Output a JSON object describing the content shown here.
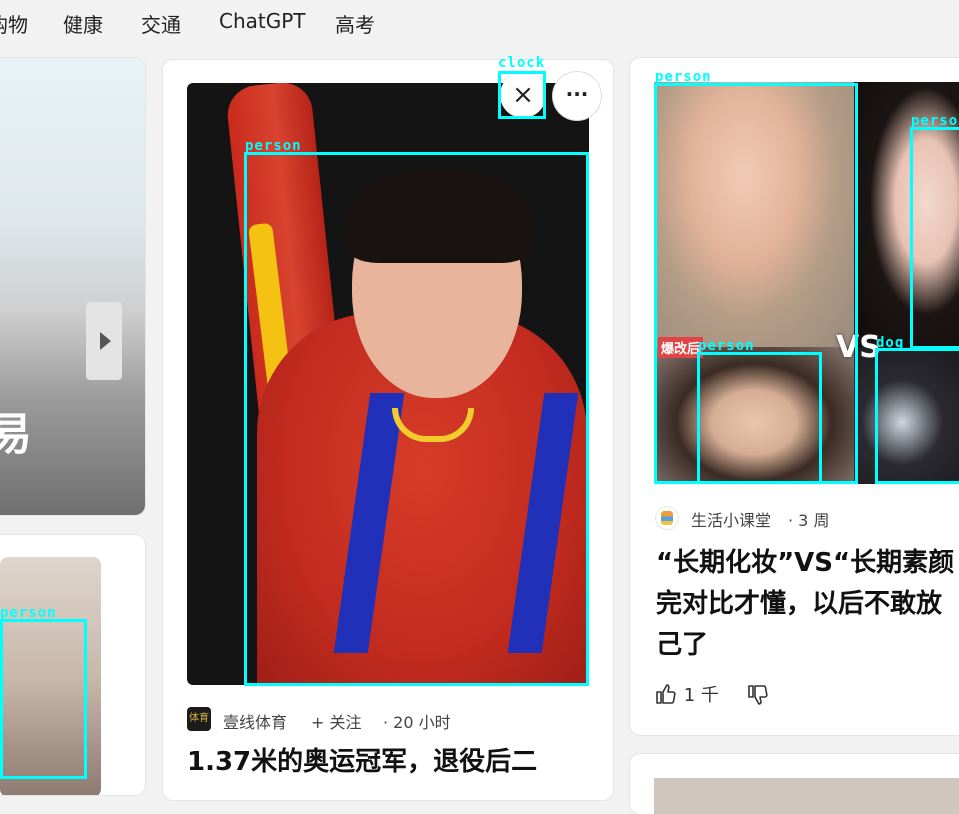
{
  "nav": {
    "items": [
      "购物",
      "健康",
      "交通",
      "ChatGPT",
      "高考"
    ]
  },
  "left_top": {
    "caption": "易"
  },
  "center_card": {
    "source": "壹线体育",
    "source_logo_text": "体育",
    "follow": "关注",
    "time": "· 20 小时",
    "title_line1": "1.37米的奥运冠军，退役后二",
    "close_glyph": "×",
    "more_glyph": "···"
  },
  "right_card": {
    "source": "生活小课堂",
    "time": "· 3 周",
    "vs_text": "VS",
    "photo_tag": "爆改后",
    "title_line1": "“长期化妆”VS“长期素颜",
    "title_line2": "完对比才懂，以后不敢放",
    "title_line3": "己了",
    "likes": "1 千",
    "like_icon": "thumbs-up-icon",
    "dislike_icon": "thumbs-down-icon"
  },
  "detections": {
    "clock": "clock",
    "person_center": "person",
    "person_left": "person",
    "person_right_top": "person",
    "person_right_2": "person",
    "person_right_bottom": "person",
    "dog": "dog"
  },
  "colors": {
    "detection": "#00ffff",
    "background": "#f2f2f2"
  }
}
